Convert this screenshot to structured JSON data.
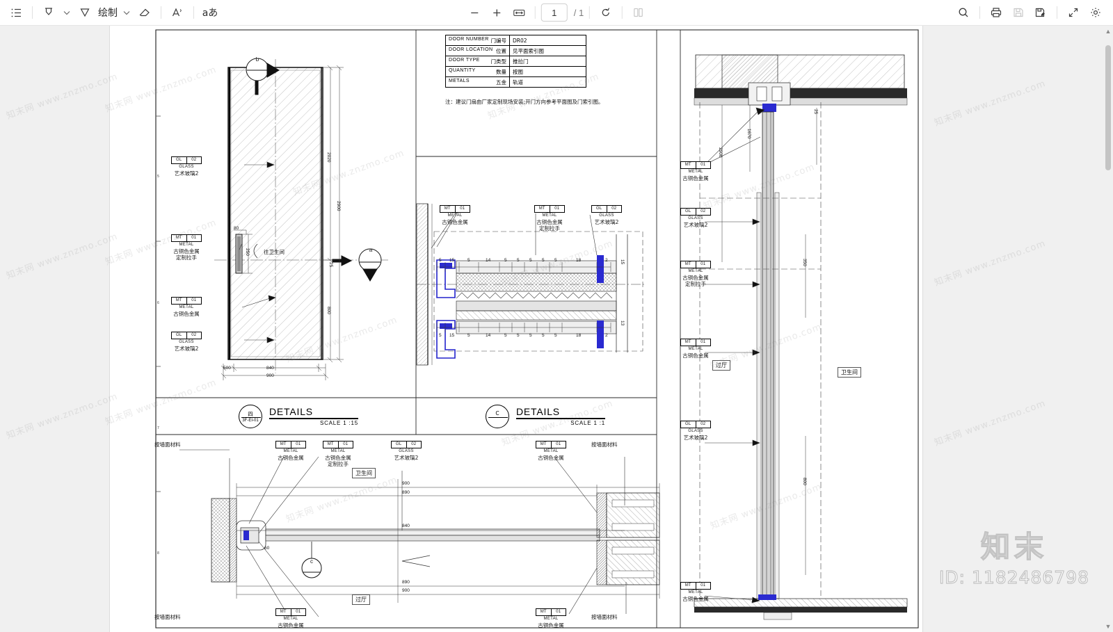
{
  "toolbar": {
    "left_tools": [
      {
        "name": "outline-list-icon",
        "glyph": "list"
      },
      {
        "name": "highlighter-icon",
        "glyph": "highlighter"
      },
      {
        "name": "highlighter-dropdown-chevron-icon",
        "glyph": "chevron"
      },
      {
        "name": "pen-draw-icon",
        "glyph": "pen"
      },
      {
        "name": "draw-label",
        "label": "绘制"
      },
      {
        "name": "draw-dropdown-chevron-icon",
        "glyph": "chevron"
      },
      {
        "name": "eraser-icon",
        "glyph": "eraser"
      },
      {
        "name": "text-annotate-icon",
        "glyph": "A"
      },
      {
        "name": "font-size-icon",
        "glyph": "aあ"
      }
    ],
    "draw_label": "绘制",
    "font_size_label": "aあ",
    "zoom_out_title": "缩小",
    "zoom_in_title": "放大",
    "fit_width_title": "适合宽度",
    "page_current": "1",
    "page_total": "/ 1",
    "rotate_title": "旋转",
    "dual_page_title": "双页",
    "search_title": "搜索",
    "print_title": "打印",
    "save_title": "保存",
    "save_as_title": "另存为",
    "fullscreen_title": "全屏",
    "settings_title": "设置"
  },
  "schedule": {
    "rows": [
      {
        "en": "DOOR  NUMBER",
        "cn": "门编号",
        "value": "DR02"
      },
      {
        "en": "DOOR  LOCATION",
        "cn": "位置",
        "value": "见平面索引图"
      },
      {
        "en": "DOOR  TYPE",
        "cn": "门类型",
        "value": "推拉门"
      },
      {
        "en": "QUANTITY",
        "cn": "数量",
        "value": "按图"
      },
      {
        "en": "METALS",
        "cn": "五金",
        "value": "轨道"
      }
    ],
    "note": "注：建议门扇由厂家定制现场安装;开门方向参考平面图及门索引图。"
  },
  "material_tags": {
    "glass": {
      "code": "GL",
      "num": "02",
      "caption": "GLASS",
      "cn": "艺术玻璃2"
    },
    "metal": {
      "code": "MT",
      "num": "01",
      "caption": "METAL",
      "cn": "古铜色金属"
    },
    "metal_handle_cn": "定制拉手",
    "wall_finish_cn": "按墙面材料"
  },
  "elevation": {
    "marker_top": "b",
    "marker_right": "a",
    "to_bathroom": "往卫生间",
    "dims_vertical": [
      "2020",
      "2900",
      "800"
    ],
    "dims_horizontal": [
      "500",
      "840",
      "900"
    ],
    "dim_handle_w": "80",
    "dim_handle_h": "250",
    "dim_small": "25"
  },
  "detail_titles": [
    {
      "circle_top": "四",
      "circle_bottom": "3F-EI-01",
      "title": "DETAILS",
      "scale": "SCALE  1 :15"
    },
    {
      "circle_top": "C",
      "circle_bottom": "",
      "title": "DETAILS",
      "scale": "SCALE  1 :1"
    }
  ],
  "center_detail": {
    "dim_chain_top": [
      "5",
      "15",
      "5",
      "14",
      "5",
      "5",
      "5",
      "5",
      "5",
      "18",
      "2"
    ],
    "dim_chain_bottom": [
      "5",
      "15",
      "5",
      "14",
      "5",
      "5",
      "5",
      "5",
      "5",
      "18",
      "2"
    ],
    "dim_right": [
      "15",
      "13"
    ]
  },
  "section_right": {
    "dims": [
      "2900",
      "1670",
      "25",
      "350",
      "800"
    ],
    "room_left": "过厅",
    "room_right": "卫生间"
  },
  "plan_bottom": {
    "dims": [
      "900",
      "890",
      "840",
      "890",
      "900",
      "60"
    ],
    "room_left": "卫生间",
    "room_right": "过厅",
    "marker": "c"
  },
  "watermarks": {
    "site_text": "知末网 www.znzmo.com",
    "brand": "知末",
    "id_label": "ID: 1182486798"
  }
}
